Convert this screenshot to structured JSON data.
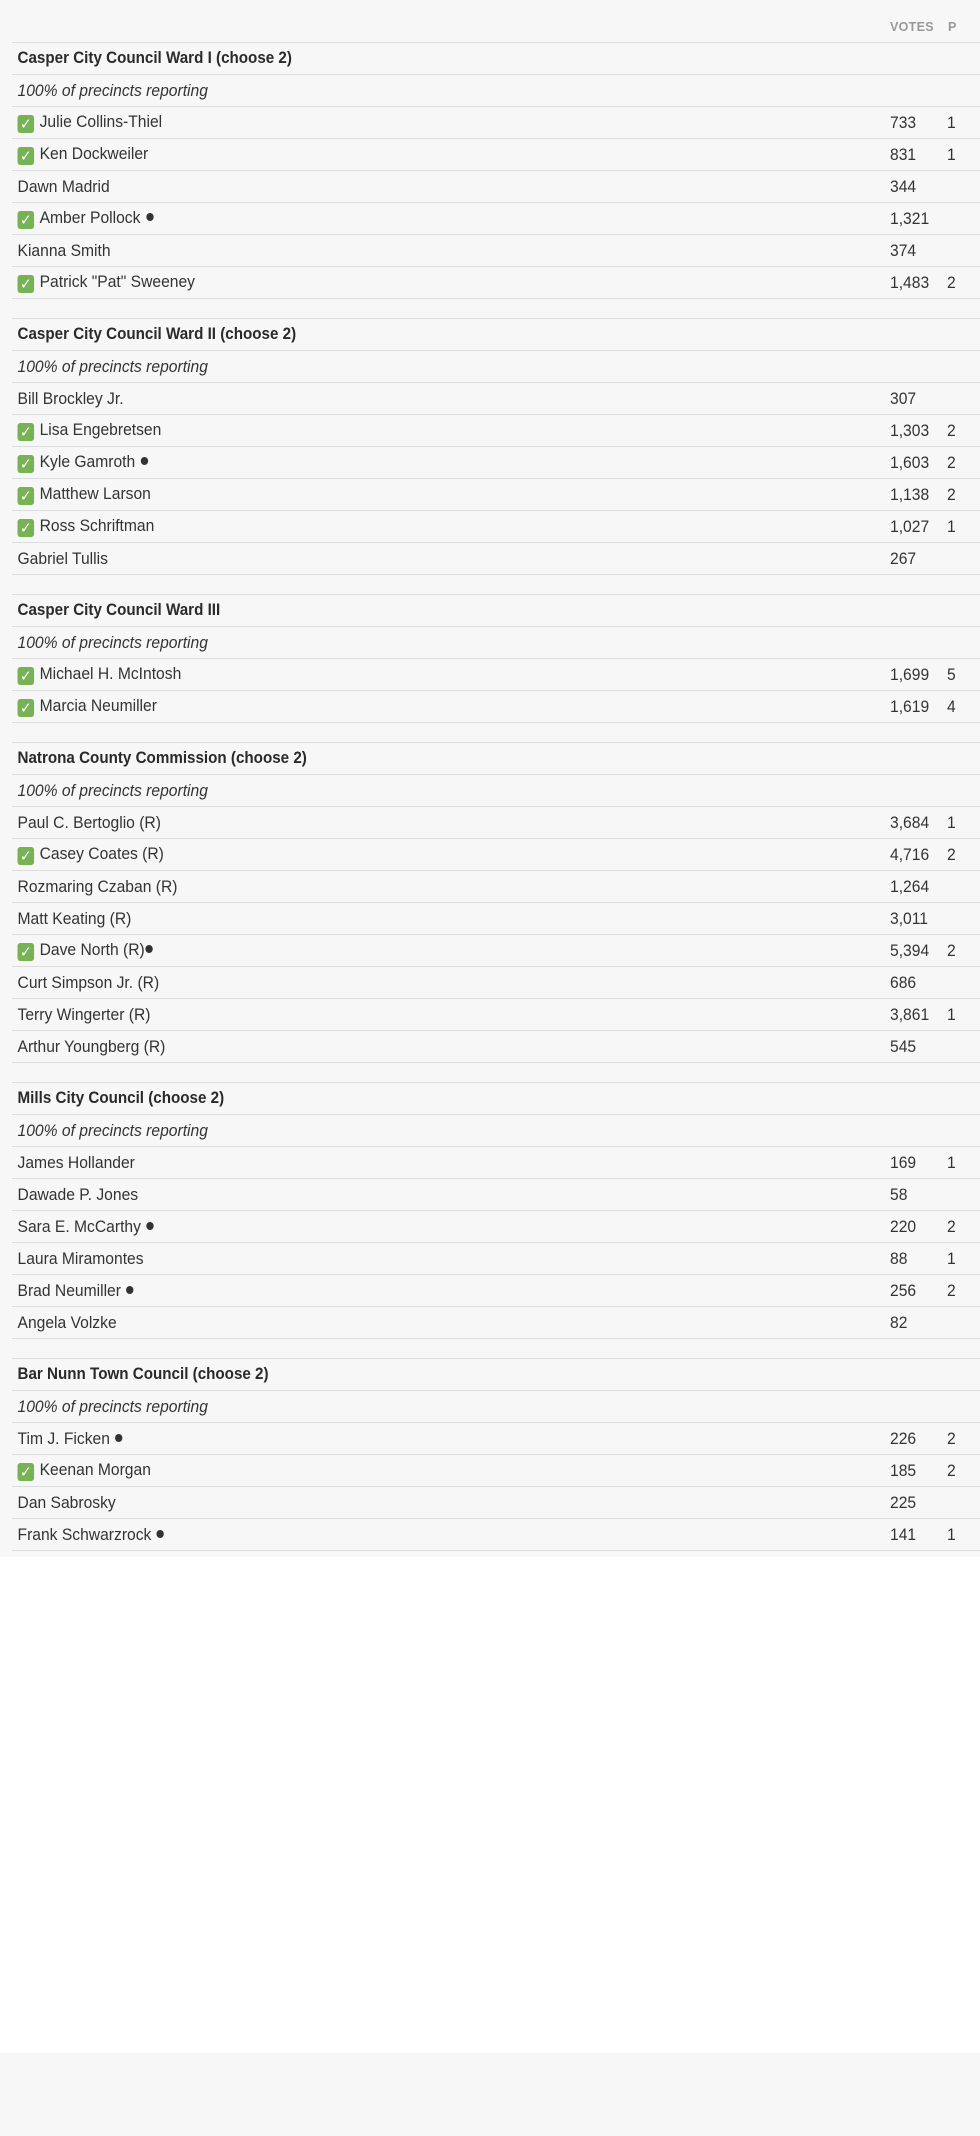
{
  "columns": {
    "name": "",
    "votes": "VOTES",
    "pct": "P"
  },
  "races": [
    {
      "title": "Casper City Council Ward I (choose 2)",
      "reporting": "100% of precincts reporting",
      "candidates": [
        {
          "name": "Julie Collins-Thiel",
          "winner": true,
          "incumbent": false,
          "votes": "733",
          "pct": "1"
        },
        {
          "name": "Ken Dockweiler",
          "winner": true,
          "incumbent": false,
          "votes": "831",
          "pct": "1"
        },
        {
          "name": "Dawn Madrid",
          "winner": false,
          "incumbent": false,
          "votes": "344",
          "pct": ""
        },
        {
          "name": "Amber Pollock",
          "winner": true,
          "incumbent": true,
          "votes": "1,321",
          "pct": ""
        },
        {
          "name": "Kianna Smith",
          "winner": false,
          "incumbent": false,
          "votes": "374",
          "pct": ""
        },
        {
          "name": "Patrick \"Pat\" Sweeney",
          "winner": true,
          "incumbent": false,
          "votes": "1,483",
          "pct": "2"
        }
      ]
    },
    {
      "title": "Casper City Council Ward II (choose 2)",
      "reporting": "100% of precincts reporting",
      "candidates": [
        {
          "name": "Bill Brockley Jr.",
          "winner": false,
          "incumbent": false,
          "votes": "307",
          "pct": ""
        },
        {
          "name": "Lisa Engebretsen",
          "winner": true,
          "incumbent": false,
          "votes": "1,303",
          "pct": "2"
        },
        {
          "name": "Kyle Gamroth",
          "winner": true,
          "incumbent": true,
          "votes": "1,603",
          "pct": "2"
        },
        {
          "name": "Matthew Larson",
          "winner": true,
          "incumbent": false,
          "votes": "1,138",
          "pct": "2"
        },
        {
          "name": "Ross Schriftman",
          "winner": true,
          "incumbent": false,
          "votes": "1,027",
          "pct": "1"
        },
        {
          "name": "Gabriel Tullis",
          "winner": false,
          "incumbent": false,
          "votes": "267",
          "pct": ""
        }
      ]
    },
    {
      "title": "Casper City Council Ward III",
      "reporting": "100% of precincts reporting",
      "candidates": [
        {
          "name": "Michael H. McIntosh",
          "winner": true,
          "incumbent": false,
          "votes": "1,699",
          "pct": "5"
        },
        {
          "name": "Marcia Neumiller",
          "winner": true,
          "incumbent": false,
          "votes": "1,619",
          "pct": "4"
        }
      ]
    },
    {
      "title": "Natrona County Commission (choose 2)",
      "reporting": "100% of precincts reporting",
      "candidates": [
        {
          "name": "Paul C. Bertoglio (R)",
          "winner": false,
          "incumbent": false,
          "votes": "3,684",
          "pct": "1"
        },
        {
          "name": "Casey Coates (R)",
          "winner": true,
          "incumbent": false,
          "votes": "4,716",
          "pct": "2"
        },
        {
          "name": "Rozmaring Czaban (R)",
          "winner": false,
          "incumbent": false,
          "votes": "1,264",
          "pct": ""
        },
        {
          "name": "Matt Keating (R)",
          "winner": false,
          "incumbent": false,
          "votes": "3,011",
          "pct": ""
        },
        {
          "name": "Dave North (R)",
          "winner": true,
          "incumbent": true,
          "tight": true,
          "votes": "5,394",
          "pct": "2"
        },
        {
          "name": "Curt Simpson Jr. (R)",
          "winner": false,
          "incumbent": false,
          "votes": "686",
          "pct": ""
        },
        {
          "name": "Terry Wingerter (R)",
          "winner": false,
          "incumbent": false,
          "votes": "3,861",
          "pct": "1"
        },
        {
          "name": "Arthur Youngberg (R)",
          "winner": false,
          "incumbent": false,
          "votes": "545",
          "pct": ""
        }
      ]
    },
    {
      "title": "Mills City Council (choose 2)",
      "reporting": "100% of precincts reporting",
      "candidates": [
        {
          "name": "James Hollander",
          "winner": false,
          "incumbent": false,
          "votes": "169",
          "pct": "1"
        },
        {
          "name": "Dawade P. Jones",
          "winner": false,
          "incumbent": false,
          "votes": "58",
          "pct": ""
        },
        {
          "name": "Sara E. McCarthy",
          "winner": false,
          "incumbent": true,
          "votes": "220",
          "pct": "2"
        },
        {
          "name": "Laura Miramontes",
          "winner": false,
          "incumbent": false,
          "votes": "88",
          "pct": "1"
        },
        {
          "name": "Brad Neumiller",
          "winner": false,
          "incumbent": true,
          "votes": "256",
          "pct": "2"
        },
        {
          "name": "Angela Volzke",
          "winner": false,
          "incumbent": false,
          "votes": "82",
          "pct": ""
        }
      ]
    },
    {
      "title": "Bar Nunn Town Council (choose 2)",
      "reporting": "100% of precincts reporting",
      "candidates": [
        {
          "name": "Tim J. Ficken",
          "winner": false,
          "incumbent": true,
          "votes": "226",
          "pct": "2"
        },
        {
          "name": "Keenan Morgan",
          "winner": true,
          "incumbent": false,
          "votes": "185",
          "pct": "2"
        },
        {
          "name": "Dan Sabrosky",
          "winner": false,
          "incumbent": false,
          "votes": "225",
          "pct": ""
        },
        {
          "name": "Frank Schwarzrock",
          "winner": false,
          "incumbent": true,
          "votes": "141",
          "pct": "1"
        }
      ]
    }
  ],
  "icons": {
    "winner": "check-mark-icon",
    "incumbent": "bullet-dot-icon"
  },
  "colors": {
    "winner_check": "#77b255",
    "divider": "#dcdcdc",
    "header_text": "#999999"
  }
}
